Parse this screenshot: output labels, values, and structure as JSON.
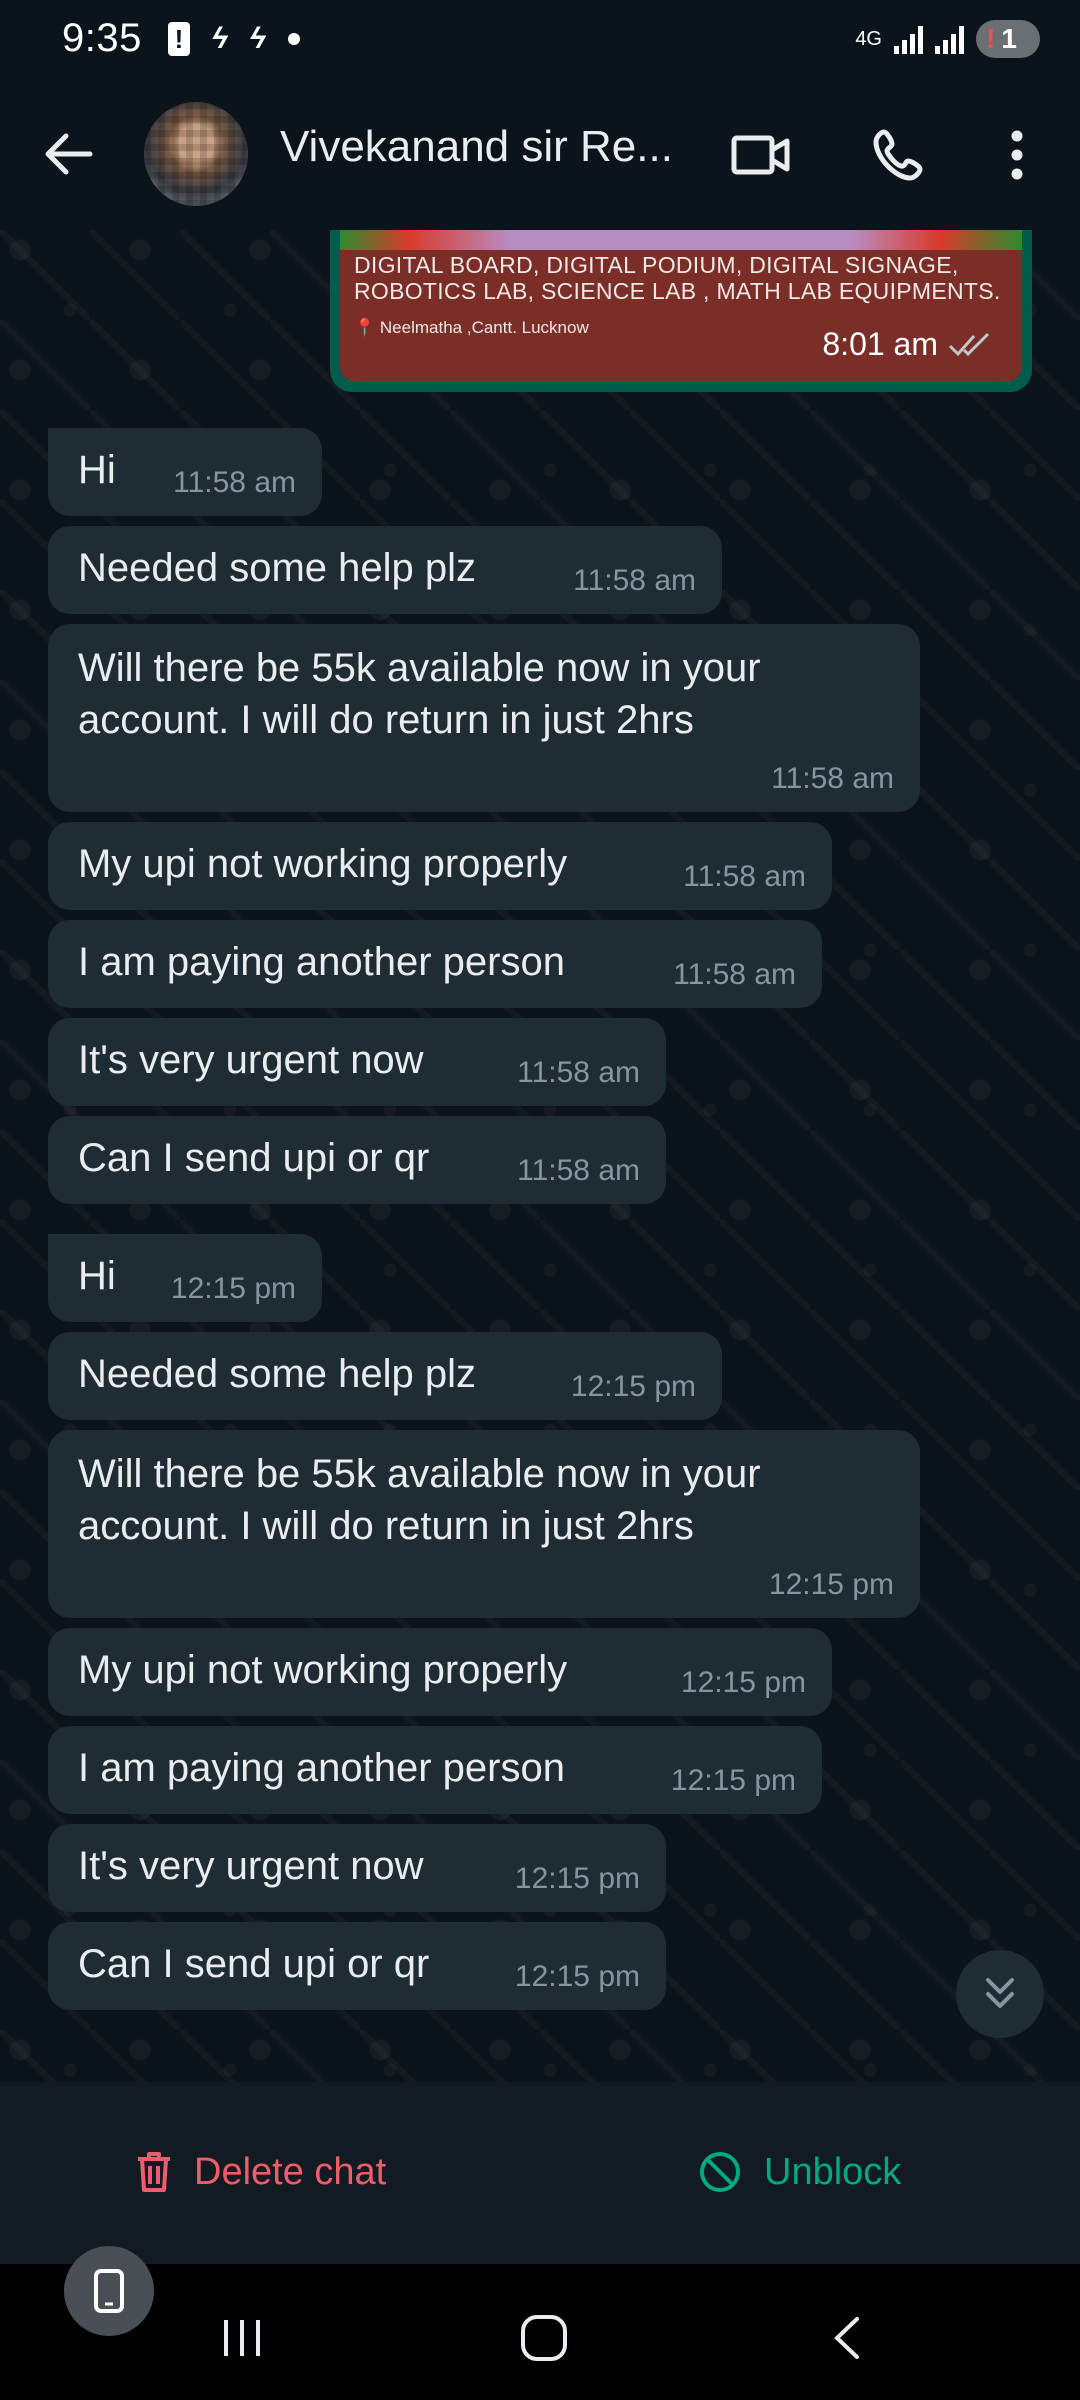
{
  "status_bar": {
    "time": "9:35",
    "network": "4G",
    "notification_count": "1"
  },
  "header": {
    "contact_name": "Vivekanand sir Re..."
  },
  "image_message": {
    "line1": "DIGITAL BOARD,  DIGITAL PODIUM,  DIGITAL SIGNAGE,",
    "line2": "ROBOTICS LAB, SCIENCE LAB , MATH LAB EQUIPMENTS.",
    "location": "Neelmatha ,Cantt. Lucknow",
    "time": "8:01 am"
  },
  "messages": [
    {
      "text": "Hi",
      "time": "11:58 am"
    },
    {
      "text": "Needed some help plz",
      "time": "11:58 am"
    },
    {
      "text": "Will there be 55k available now in your",
      "text2": "account. I will do return in just 2hrs",
      "time": "11:58 am"
    },
    {
      "text": "My upi not working properly",
      "time": "11:58 am"
    },
    {
      "text": "I am paying another person",
      "time": "11:58 am"
    },
    {
      "text": "It's very urgent now",
      "time": "11:58 am"
    },
    {
      "text": "Can I send upi or qr",
      "time": "11:58 am"
    },
    {
      "text": "Hi",
      "time": "12:15 pm"
    },
    {
      "text": "Needed some help plz",
      "time": "12:15 pm"
    },
    {
      "text": "Will there be 55k available now in your",
      "text2": "account. I will do return in just 2hrs",
      "time": "12:15 pm"
    },
    {
      "text": "My upi not working properly",
      "time": "12:15 pm"
    },
    {
      "text": "I am paying another person",
      "time": "12:15 pm"
    },
    {
      "text": "It's very urgent now",
      "time": "12:15 pm"
    },
    {
      "text": "Can I send upi or qr",
      "time": "12:15 pm"
    }
  ],
  "bottom_actions": {
    "delete_label": "Delete chat",
    "unblock_label": "Unblock"
  },
  "colors": {
    "background": "#0b141a",
    "incoming_bubble": "#202c33",
    "outgoing_bubble": "#005c4b",
    "delete": "#f15c6d",
    "unblock": "#00a884"
  }
}
